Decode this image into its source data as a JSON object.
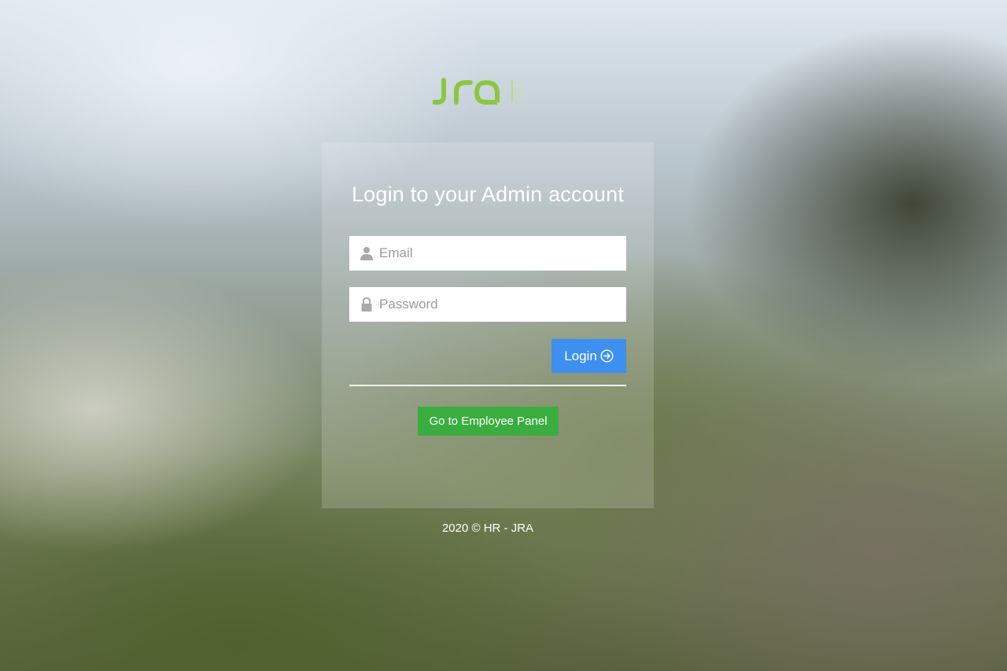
{
  "brand": {
    "logo_text": "JRA",
    "logo_color": "#8cc63f"
  },
  "login_card": {
    "title": "Login to your Admin account",
    "email": {
      "placeholder": "Email",
      "value": "",
      "icon": "user-icon"
    },
    "password": {
      "placeholder": "Password",
      "value": "",
      "icon": "lock-icon"
    },
    "login_button": {
      "label": "Login",
      "icon": "arrow-circle-right-icon",
      "color": "#3d8ff0"
    },
    "employee_button": {
      "label": "Go to Employee Panel",
      "color": "#3aad3f"
    }
  },
  "footer": {
    "text": "2020 © HR - JRA"
  }
}
